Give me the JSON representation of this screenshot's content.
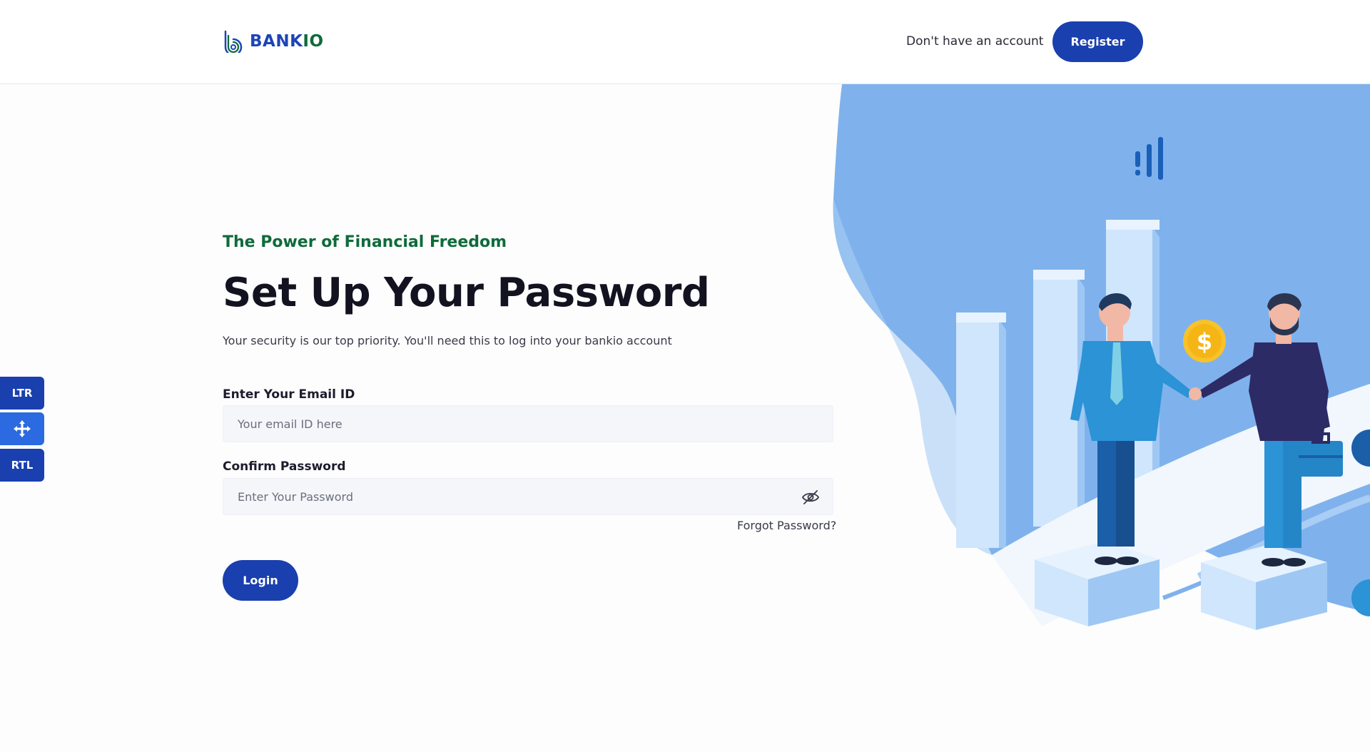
{
  "header": {
    "brand_prefix": "BANK",
    "brand_suffix": "IO",
    "no_account_text": "Don't have an account",
    "register_label": "Register"
  },
  "hero": {
    "tagline": "The Power of Financial Freedom",
    "title": "Set Up Your Password",
    "subtitle": "Your security is our top priority. You'll need this to log into your bankio account"
  },
  "form": {
    "email_label": "Enter Your Email ID",
    "email_placeholder": "Your email ID here",
    "password_label": "Confirm Password",
    "password_placeholder": "Enter Your Password",
    "forgot_label": "Forgot Password?",
    "login_label": "Login"
  },
  "side_toggle": {
    "ltr_label": "LTR",
    "rtl_label": "RTL"
  },
  "icons": {
    "logo": "bankio-logo-icon",
    "eye": "eye-slash-icon",
    "move": "move-arrows-icon",
    "dollar": "dollar-coin-icon"
  },
  "colors": {
    "primary": "#1a3fae",
    "accent_green": "#0e6b3a",
    "illustration_blue": "#7fb2ec"
  }
}
